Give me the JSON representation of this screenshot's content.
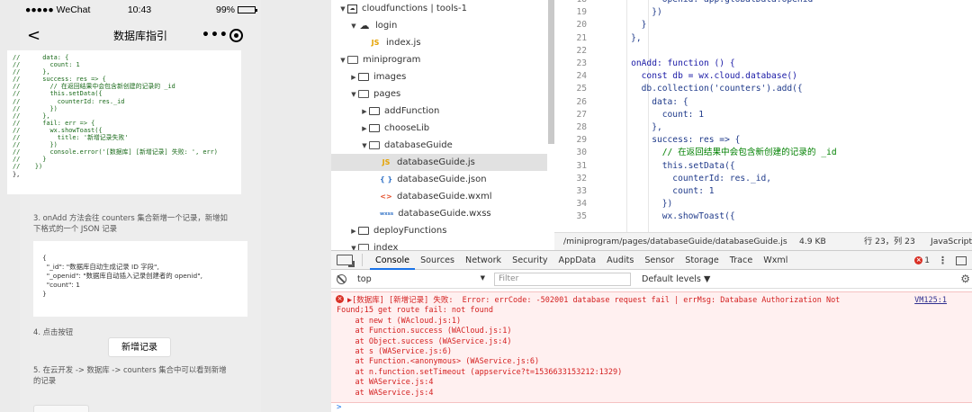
{
  "simulator": {
    "status": {
      "carrier": "●●●●● WeChat",
      "time": "10:43",
      "battery": "99%",
      "battery_level": 0.99
    },
    "nav_title": "数据库指引",
    "nav_back": "<",
    "capsule_dots": "•••",
    "code_lines": [
      "//      data: {",
      "//        count: 1",
      "//      },",
      "//      success: res => {",
      "//        // 在返回结果中会包含新创建的记录的 _id",
      "//        this.setData({",
      "//          counterId: res._id",
      "//        })",
      "//      },",
      "//      fail: err => {",
      "//        wx.showToast({",
      "//          title: '新增记录失败'",
      "//        })",
      "//        console.error('[数据库] [新增记录] 失败: ', err)",
      "//      }",
      "//    })",
      "},"
    ],
    "step3_line1": "3. onAdd 方法会往 counters 集合新增一个记录，新增如",
    "step3_line2": "下格式的一个 JSON 记录",
    "json_lines": [
      "{",
      "  \"_id\": \"数据库自动生成记录 ID 字段\",",
      "  \"_openid\": \"数据库自动插入记录创建者的 openid\",",
      "  \"count\": 1",
      "}"
    ],
    "step4": "4. 点击按钮",
    "add_button": "新增记录",
    "step5_line1": "5. 在云开发 -> 数据库 -> counters 集合中可以看到新增",
    "step5_line2": "的记录"
  },
  "tree": [
    {
      "label": "cloudfunctions | tools-1",
      "icon": "cloud-function-folder-icon",
      "twisty": "▼"
    },
    {
      "label": "login",
      "icon": "cloud-icon",
      "twisty": "▼"
    },
    {
      "label": "index.js",
      "icon": "js-file-icon",
      "twisty": "",
      "badge": "JS"
    },
    {
      "label": "miniprogram",
      "icon": "folder-open-icon",
      "twisty": "▼"
    },
    {
      "label": "images",
      "icon": "folder-icon",
      "twisty": "▶"
    },
    {
      "label": "pages",
      "icon": "folder-open-icon",
      "twisty": "▼"
    },
    {
      "label": "addFunction",
      "icon": "folder-icon",
      "twisty": "▶"
    },
    {
      "label": "chooseLib",
      "icon": "folder-icon",
      "twisty": "▶"
    },
    {
      "label": "databaseGuide",
      "icon": "folder-open-icon",
      "twisty": "▼"
    },
    {
      "label": "databaseGuide.js",
      "icon": "js-file-icon",
      "twisty": "",
      "badge": "JS",
      "active": true
    },
    {
      "label": "databaseGuide.json",
      "icon": "json-file-icon",
      "twisty": "",
      "badge": "{ }"
    },
    {
      "label": "databaseGuide.wxml",
      "icon": "wxml-file-icon",
      "twisty": "",
      "badge": "<>"
    },
    {
      "label": "databaseGuide.wxss",
      "icon": "wxss-file-icon",
      "twisty": "",
      "badge": "wxss"
    },
    {
      "label": "deployFunctions",
      "icon": "folder-icon",
      "twisty": "▶"
    },
    {
      "label": "index",
      "icon": "folder-open-icon",
      "twisty": "▼"
    }
  ],
  "editor": {
    "lines": [
      {
        "n": "18",
        "text": "          openid: app.globalData.openid"
      },
      {
        "n": "19",
        "text": "        })"
      },
      {
        "n": "20",
        "text": "      }"
      },
      {
        "n": "21",
        "text": "    },"
      },
      {
        "n": "22",
        "text": ""
      },
      {
        "n": "23",
        "text": "    onAdd: function () {"
      },
      {
        "n": "24",
        "text": "      const db = wx.cloud.database()"
      },
      {
        "n": "25",
        "text": "      db.collection('counters').add({"
      },
      {
        "n": "26",
        "text": "        data: {"
      },
      {
        "n": "27",
        "text": "          count: 1"
      },
      {
        "n": "28",
        "text": "        },"
      },
      {
        "n": "29",
        "text": "        success: res => {"
      },
      {
        "n": "30",
        "text": "          // 在返回结果中会包含新创建的记录的 _id"
      },
      {
        "n": "31",
        "text": "          this.setData({"
      },
      {
        "n": "32",
        "text": "            counterId: res._id,"
      },
      {
        "n": "33",
        "text": "            count: 1"
      },
      {
        "n": "34",
        "text": "          })"
      },
      {
        "n": "35",
        "text": "          wx.showToast({"
      }
    ],
    "status": {
      "path": "/miniprogram/pages/databaseGuide/databaseGuide.js",
      "size": "4.9 KB",
      "cursor": "行 23，列 23",
      "language": "JavaScript"
    }
  },
  "devtools": {
    "tabs": [
      "Console",
      "Sources",
      "Network",
      "Security",
      "AppData",
      "Audits",
      "Sensor",
      "Storage",
      "Trace",
      "Wxml"
    ],
    "active_tab": "Console",
    "error_count": "1",
    "context": "top",
    "filter_placeholder": "Filter",
    "levels": "Default levels ▼",
    "error_source": "VM125:1",
    "console_lines": [
      "▶[数据库] [新增记录] 失败:  Error: errCode: -502001 database request fail | errMsg: Database Authorization Not",
      "Found;15 get route fail: not found",
      "    at new t (WAcloud.js:1)",
      "    at Function.success (WACloud.js:1)",
      "    at Object.success (WAService.js:4)",
      "    at s (WAService.js:6)",
      "    at Function.<anonymous> (WAService.js:6)",
      "    at n.function.setTimeout (appservice?t=1536633153212:1329)",
      "    at WAService.js:4",
      "    at WAService.js:4"
    ],
    "prompt": ">"
  }
}
